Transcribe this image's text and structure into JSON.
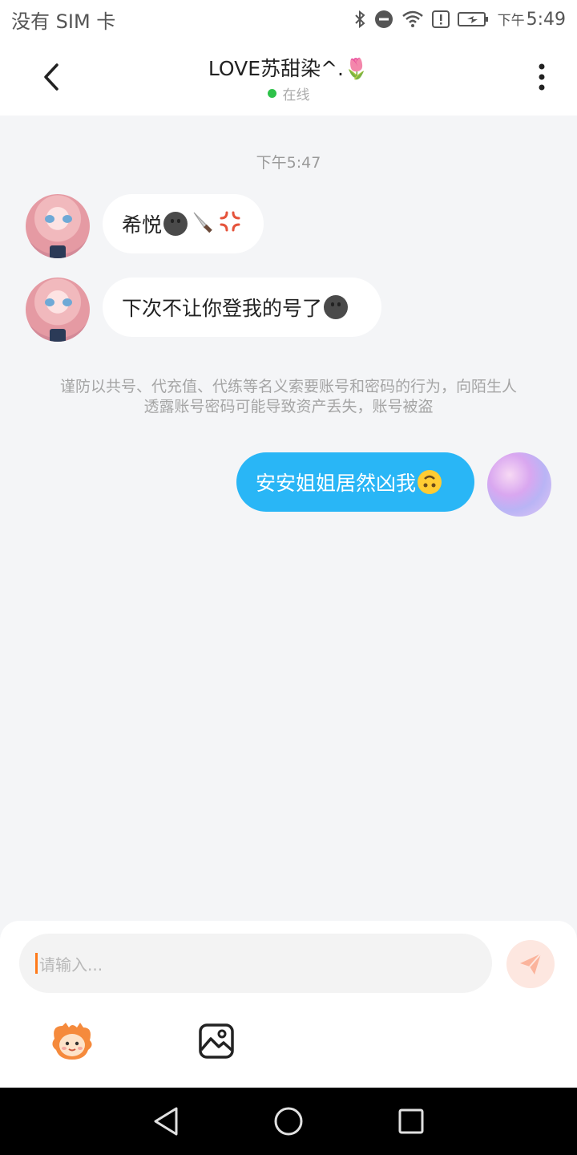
{
  "status_bar": {
    "carrier": "没有 SIM 卡",
    "time_prefix": "下午",
    "time": "5:49",
    "icons": [
      "bluetooth-icon",
      "do-not-disturb-icon",
      "wifi-icon",
      "alert-icon",
      "battery-charging-icon"
    ]
  },
  "header": {
    "title": "LOVE苏甜染^.🌷",
    "status": "在线",
    "back_icon": "chevron-left-icon",
    "more_icon": "more-vertical-icon"
  },
  "chat": {
    "timestamp": "下午5:47",
    "messages": [
      {
        "side": "in",
        "text": "希悦",
        "emojis": [
          "smiley-dark",
          "knife",
          "anger"
        ]
      },
      {
        "side": "in",
        "text": "下次不让你登我的号了",
        "emojis": [
          "smiley-dark"
        ]
      },
      {
        "side": "out",
        "text": "安安姐姐居然凶我",
        "emojis": [
          "upside-down-face"
        ]
      }
    ],
    "notice_line1": "谨防以共号、代充值、代练等名义索要账号和密码的行为，向陌生人",
    "notice_line2": "透露账号密码可能导致资产丢失，账号被盗"
  },
  "composer": {
    "placeholder": "请输入...",
    "send_icon": "send-icon",
    "tools": [
      "mascot-sticker-icon",
      "image-icon"
    ]
  },
  "nav_bar": {
    "buttons": [
      "back-triangle-icon",
      "home-circle-icon",
      "recents-square-icon"
    ]
  },
  "colors": {
    "accent_bubble": "#29b6f6",
    "online_dot": "#2ec24a",
    "caret": "#ff7a1a"
  }
}
